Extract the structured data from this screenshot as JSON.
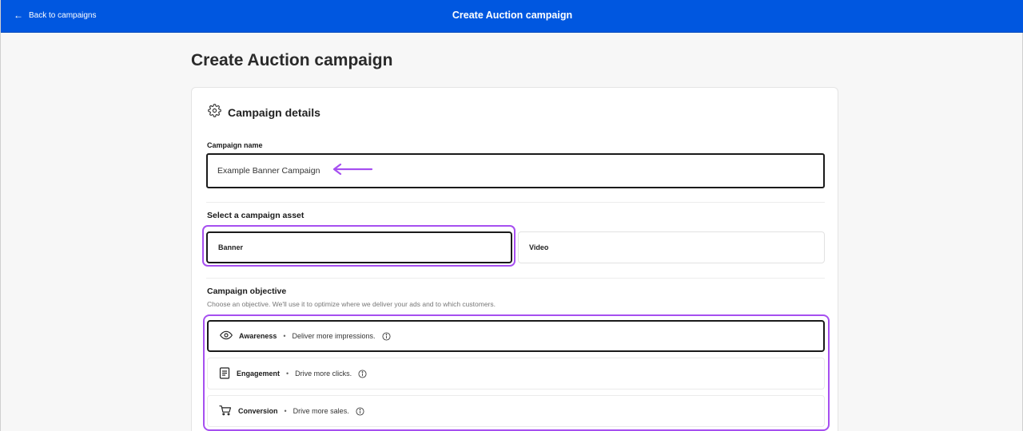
{
  "topbar": {
    "back_label": "Back to campaigns",
    "title": "Create Auction campaign",
    "background": "#0057e0"
  },
  "page": {
    "title": "Create Auction campaign"
  },
  "campaign_details": {
    "heading": "Campaign details",
    "icon": "gear-icon",
    "name_label": "Campaign name",
    "name_value": "Example Banner Campaign"
  },
  "asset": {
    "label": "Select a campaign asset",
    "options": [
      {
        "label": "Banner",
        "selected": true
      },
      {
        "label": "Video",
        "selected": false
      }
    ]
  },
  "objective": {
    "label": "Campaign objective",
    "description": "Choose an objective. We'll use it to optimize where we deliver your ads and to which customers.",
    "separator": "•",
    "options": [
      {
        "name": "Awareness",
        "detail": "Deliver more impressions.",
        "icon": "eye-icon",
        "selected": true
      },
      {
        "name": "Engagement",
        "detail": "Drive more clicks.",
        "icon": "document-icon",
        "selected": false
      },
      {
        "name": "Conversion",
        "detail": "Drive more sales.",
        "icon": "cart-icon",
        "selected": false
      }
    ]
  },
  "annotation_color": "#a64ff0"
}
